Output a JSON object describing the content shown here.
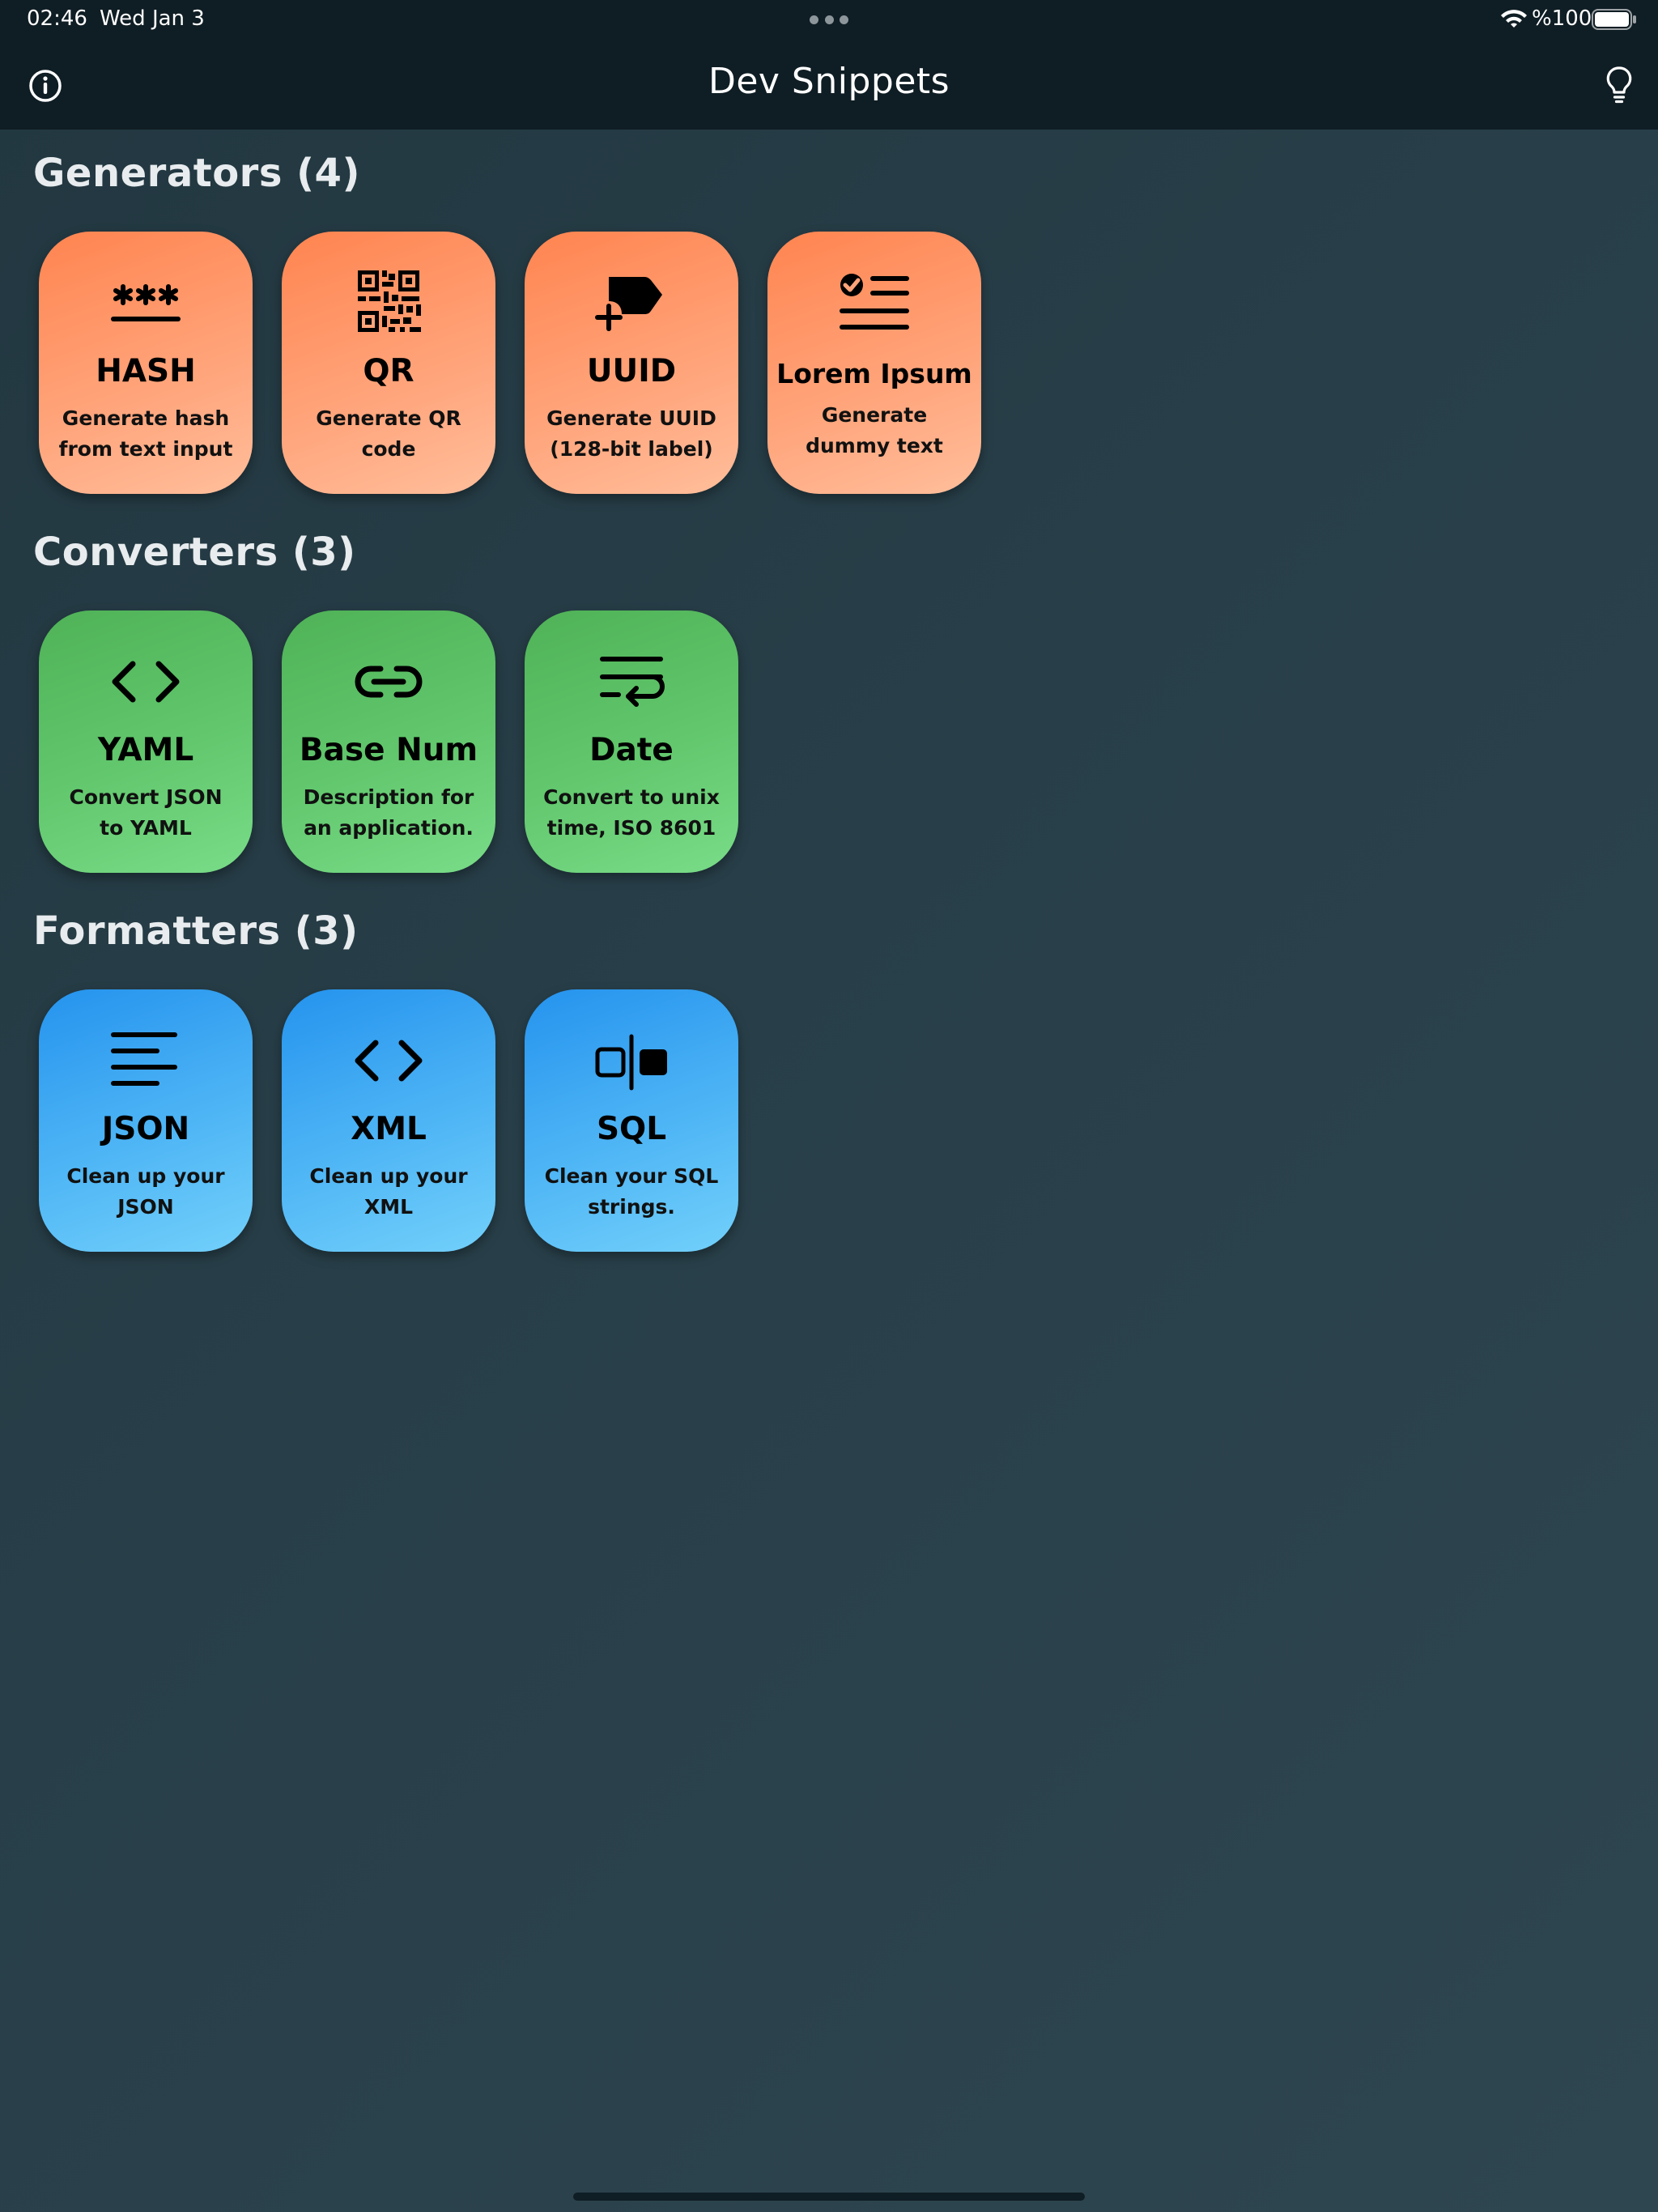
{
  "status_bar": {
    "time": "02:46",
    "date": "Wed Jan 3",
    "battery": "%100"
  },
  "nav": {
    "title": "Dev Snippets",
    "info_icon": "info-circle-icon",
    "tips_icon": "lightbulb-icon"
  },
  "colors": {
    "generators": "#ff8a58",
    "converters": "#5cbf66",
    "formatters": "#3aa6f2",
    "background": "#263c46",
    "bar": "#0f1d24"
  },
  "sections": [
    {
      "title": "Generators (4)",
      "cards": [
        {
          "icon": "asterisks-icon",
          "title": "HASH",
          "desc_1": "Generate hash",
          "desc_2": "from text input"
        },
        {
          "icon": "qr-code-icon",
          "title": "QR",
          "desc_1": "Generate QR",
          "desc_2": "code"
        },
        {
          "icon": "tag-plus-icon",
          "title": "UUID",
          "desc_1": "Generate UUID",
          "desc_2": "(128-bit label)"
        },
        {
          "icon": "checklist-icon",
          "title": "Lorem Ipsum",
          "desc_1": "Generate",
          "desc_2": "dummy text"
        }
      ]
    },
    {
      "title": "Converters (3)",
      "cards": [
        {
          "icon": "code-brackets-icon",
          "title": "YAML",
          "desc_1": "Convert JSON",
          "desc_2": "to YAML"
        },
        {
          "icon": "link-icon",
          "title": "Base Num",
          "desc_1": "Description for",
          "desc_2": "an application."
        },
        {
          "icon": "text-wrap-icon",
          "title": "Date",
          "desc_1": "Convert to unix",
          "desc_2": "time, ISO 8601"
        }
      ]
    },
    {
      "title": "Formatters (3)",
      "cards": [
        {
          "icon": "align-left-icon",
          "title": "JSON",
          "desc_1": "Clean up your",
          "desc_2": "JSON"
        },
        {
          "icon": "code-brackets-icon",
          "title": "XML",
          "desc_1": "Clean up your",
          "desc_2": "XML"
        },
        {
          "icon": "split-square-icon",
          "title": "SQL",
          "desc_1": "Clean your SQL",
          "desc_2": "strings."
        }
      ]
    }
  ]
}
